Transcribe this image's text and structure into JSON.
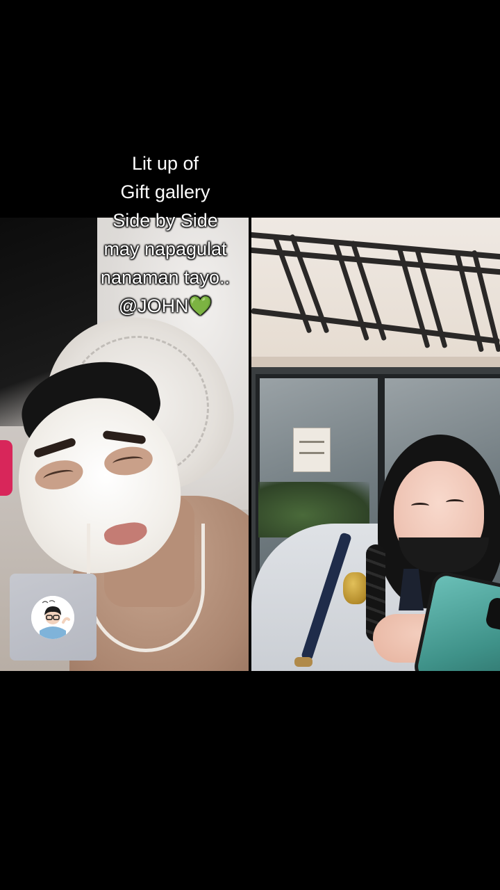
{
  "caption": {
    "lines": [
      "Lit up of",
      "Gift gallery",
      "Side by Side",
      "may napagulat",
      "nanaman tayo..",
      "@JOHN💚"
    ]
  },
  "colors": {
    "background": "#000000",
    "caption_text": "#ffffff",
    "avatar_tile": "#c6c8cf",
    "heart": "#5ad45a"
  },
  "icons": {
    "avatar": "profile-avatar-cartoon"
  }
}
